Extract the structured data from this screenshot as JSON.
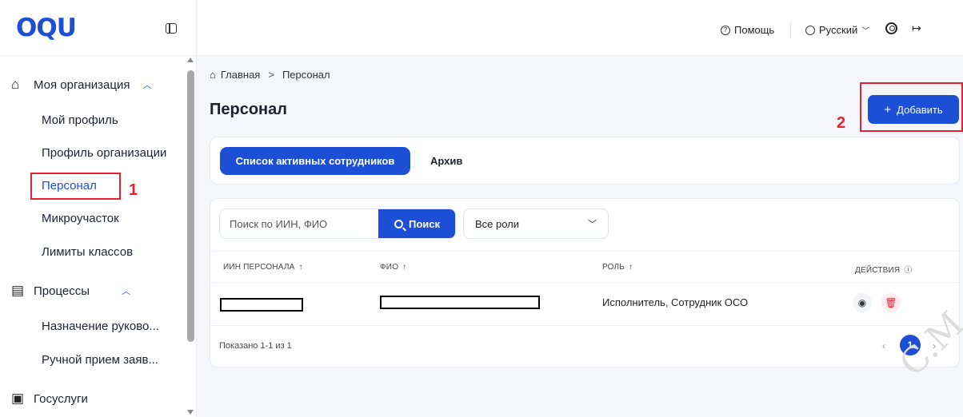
{
  "sidebar": {
    "logo": "OQU",
    "groups": [
      {
        "label": "Моя организация",
        "icon": "building-icon",
        "expanded": true
      },
      {
        "label": "Процессы",
        "icon": "clipboard-icon",
        "expanded": true
      },
      {
        "label": "Госуслуги",
        "icon": "inbox-icon"
      }
    ],
    "items": [
      {
        "label": "Мой профиль"
      },
      {
        "label": "Профиль организации"
      },
      {
        "label": "Персонал",
        "active": true
      },
      {
        "label": "Микроучасток"
      },
      {
        "label": "Лимиты классов"
      },
      {
        "label": "Назначение руково..."
      },
      {
        "label": "Ручной прием заяв..."
      }
    ]
  },
  "header": {
    "help_label": "Помощь",
    "language_label": "Русский"
  },
  "breadcrumb": {
    "home": "Главная",
    "separator": ">",
    "current": "Персонал"
  },
  "page": {
    "title": "Персонал",
    "add_button": "Добавить"
  },
  "tabs": [
    {
      "label": "Список активных сотрудников",
      "active": true
    },
    {
      "label": "Архив",
      "active": false
    }
  ],
  "filters": {
    "search_placeholder": "Поиск по ИИН, ФИО",
    "search_button": "Поиск",
    "role_select_value": "Все роли"
  },
  "table": {
    "columns": [
      "ИИН ПЕРСОНАЛА",
      "ФИО",
      "РОЛЬ",
      "ДЕЙСТВИЯ"
    ],
    "rows": [
      {
        "iin": "",
        "fio": "",
        "role": "Исполнитель, Сотрудник ОСО"
      }
    ],
    "shown_text": "Показано 1-1 из 1"
  },
  "pagination": {
    "current_page": "1"
  },
  "annotations": {
    "marker_1": "1",
    "marker_2": "2",
    "color": "#e52330"
  },
  "watermark": "C.M",
  "colors": {
    "accent": "#1c4fd6",
    "danger": "#e0202e"
  }
}
